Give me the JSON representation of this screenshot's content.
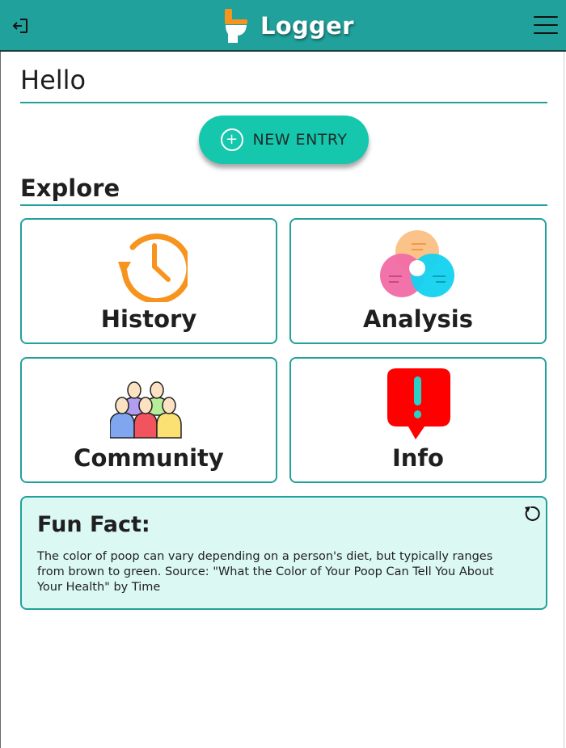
{
  "header": {
    "app_title": "Logger",
    "logout_icon": "logout-icon",
    "menu_icon": "hamburger-menu-icon",
    "brand_icon": "toilet-icon",
    "background_color": "#21a19c"
  },
  "greeting": "Hello",
  "new_entry": {
    "label": "NEW ENTRY",
    "icon": "plus-circle-icon",
    "color": "#14c7ad"
  },
  "explore": {
    "title": "Explore",
    "cards": [
      {
        "label": "History",
        "icon": "clock-history-icon"
      },
      {
        "label": "Analysis",
        "icon": "venn-diagram-icon"
      },
      {
        "label": "Community",
        "icon": "people-group-icon"
      },
      {
        "label": "Info",
        "icon": "exclamation-bubble-icon"
      }
    ]
  },
  "fun_fact": {
    "title": "Fun Fact:",
    "text": "The color of poop can vary depending on a person's diet, but typically ranges from brown to green. Source: \"What the Color of Your Poop Can Tell You About Your Health\" by Time",
    "refresh_icon": "refresh-icon",
    "background_color": "#dbf8f3"
  },
  "colors": {
    "accent": "#21a19c",
    "text": "#1f1f1f"
  }
}
